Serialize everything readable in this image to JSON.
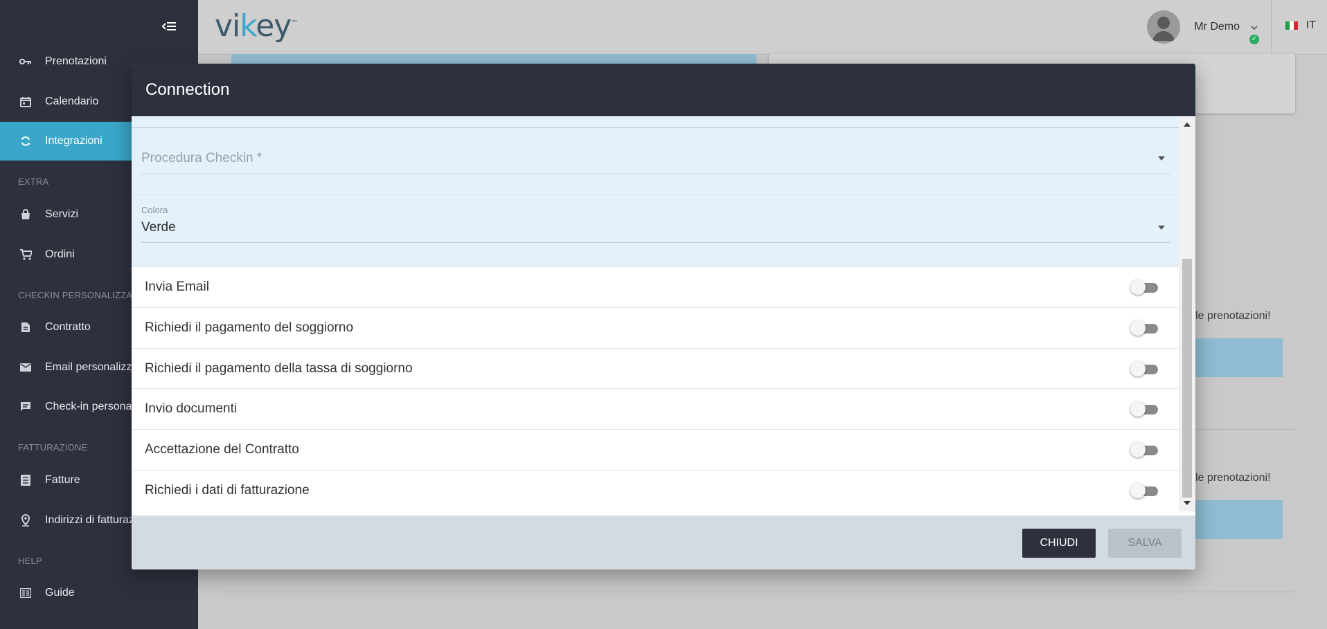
{
  "app": {
    "logo_text_a": "vi",
    "logo_text_b": "k",
    "logo_text_c": "ey",
    "logo_tm": "™"
  },
  "header": {
    "user_name": "Mr Demo",
    "language": "IT"
  },
  "sidebar": {
    "items": [
      {
        "label": "Prenotazioni",
        "icon": "key-icon"
      },
      {
        "label": "Calendario",
        "icon": "calendar-icon"
      },
      {
        "label": "Integrazioni",
        "icon": "sync-icon",
        "active": true
      },
      {
        "label": "Servizi",
        "icon": "bag-icon"
      },
      {
        "label": "Ordini",
        "icon": "cart-icon"
      },
      {
        "label": "Contratto",
        "icon": "document-icon"
      },
      {
        "label": "Email personalizza",
        "icon": "mail-icon"
      },
      {
        "label": "Check-in personal",
        "icon": "chat-icon"
      },
      {
        "label": "Fatture",
        "icon": "list-icon"
      },
      {
        "label": "Indirizzi di fatturaz",
        "icon": "location-icon"
      },
      {
        "label": "Guide",
        "icon": "guide-icon"
      }
    ],
    "sections": {
      "extra": "EXTRA",
      "checkin": "CHECKIN PERSONALIZZA",
      "billing": "FATTURAZIONE",
      "help": "HELP"
    }
  },
  "background": {
    "text1": "le prenotazioni!",
    "text2": "le prenotazioni!"
  },
  "modal": {
    "title": "Connection",
    "checkin_field": {
      "placeholder": "Procedura Checkin *"
    },
    "color_field": {
      "label": "Colora",
      "value": "Verde"
    },
    "toggles": [
      {
        "label": "Invia Email",
        "on": false
      },
      {
        "label": "Richiedi il pagamento del soggiorno",
        "on": false
      },
      {
        "label": "Richiedi il pagamento della tassa di soggiorno",
        "on": false
      },
      {
        "label": "Invio documenti",
        "on": false
      },
      {
        "label": "Accettazione del Contratto",
        "on": false
      },
      {
        "label": "Richiedi i dati di fatturazione",
        "on": false
      }
    ],
    "buttons": {
      "close": "CHIUDI",
      "save": "SALVA"
    }
  },
  "colors": {
    "sidebar_bg": "#2d313e",
    "accent": "#3aa6c9",
    "field_bg": "#e3f1fb",
    "footer_bg": "#d3dbe1",
    "online": "#27ae60"
  }
}
